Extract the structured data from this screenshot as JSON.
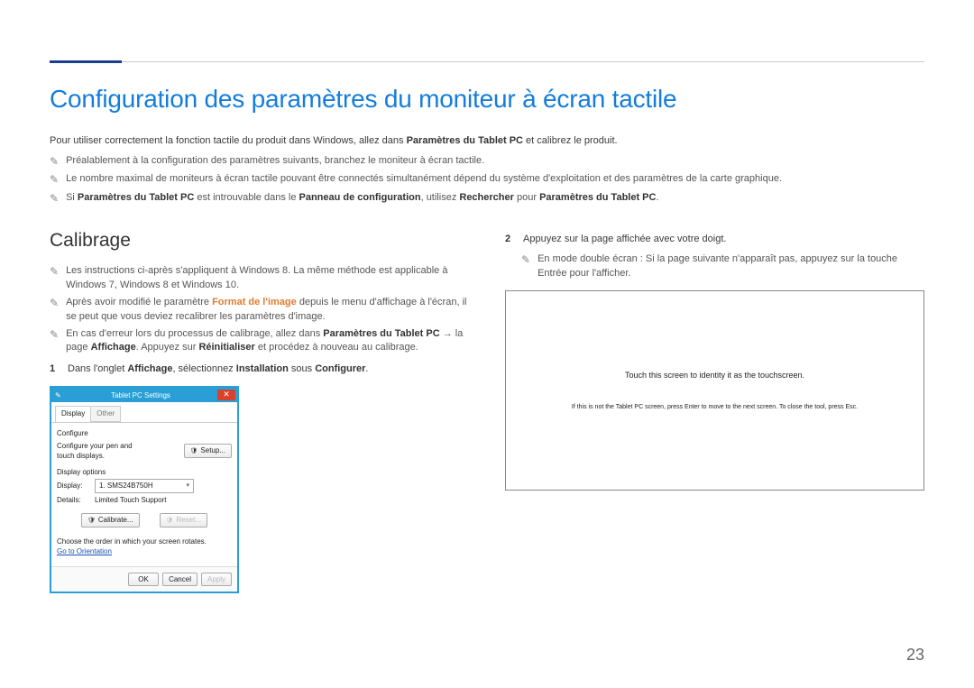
{
  "pageNumber": "23",
  "title": "Configuration des paramètres du moniteur à écran tactile",
  "intro_pre": "Pour utiliser correctement la fonction tactile du produit dans Windows, allez dans ",
  "intro_strong": "Paramètres du Tablet PC",
  "intro_post": " et calibrez le produit.",
  "notes_top": [
    "Préalablement à la configuration des paramètres suivants, branchez le moniteur à écran tactile.",
    "Le nombre maximal de moniteurs à écran tactile pouvant être connectés simultanément dépend du système d'exploitation et des paramètres de la carte graphique."
  ],
  "note3": {
    "pre": "Si ",
    "s1": "Paramètres du Tablet PC",
    "mid1": " est introuvable dans le ",
    "s2": "Panneau de configuration",
    "mid2": ", utilisez ",
    "s3": "Rechercher",
    "mid3": " pour ",
    "s4": "Paramètres du Tablet PC",
    "post": "."
  },
  "left": {
    "heading": "Calibrage",
    "note1": "Les instructions ci-après s'appliquent à Windows 8. La même méthode est applicable à Windows 7, Windows 8 et Windows 10.",
    "note2_pre": "Après avoir modifié le paramètre ",
    "note2_link": "Format de l'image",
    "note2_post": " depuis le menu d'affichage à l'écran, il se peut que vous deviez recalibrer les paramètres d'image.",
    "note3_pre": "En cas d'erreur lors du processus de calibrage, allez dans ",
    "note3_s1": "Paramètres du Tablet PC",
    "note3_arrow": " → la page ",
    "note3_s2": "Affichage",
    "note3_mid": ". Appuyez sur ",
    "note3_s3": "Réinitialiser",
    "note3_post": " et procédez à nouveau au calibrage.",
    "step1_pre": "Dans l'onglet ",
    "step1_s1": "Affichage",
    "step1_mid": ", sélectionnez ",
    "step1_s2": "Installation",
    "step1_mid2": " sous ",
    "step1_s3": "Configurer",
    "step1_post": "."
  },
  "dialog": {
    "title": "Tablet PC Settings",
    "tab_display": "Display",
    "tab_other": "Other",
    "configure_heading": "Configure",
    "configure_text": "Configure your pen and touch displays.",
    "setup_btn": "Setup...",
    "display_options": "Display options",
    "display_label": "Display:",
    "display_value": "1. SMS24B750H",
    "details_label": "Details:",
    "details_value": "Limited Touch Support",
    "calibrate_btn": "Calibrate...",
    "reset_btn": "Reset...",
    "rotate_text": "Choose the order in which your screen rotates.",
    "orientation_link": "Go to Orientation",
    "ok": "OK",
    "cancel": "Cancel",
    "apply": "Apply"
  },
  "right": {
    "step2": "Appuyez sur la page affichée avec votre doigt.",
    "note": "En mode double écran : Si la page suivante n'apparaît pas, appuyez sur la touche Entrée pour l'afficher.",
    "cal_line1": "Touch this screen to identity it as the touchscreen.",
    "cal_line2": "If this is not the Tablet PC screen, press Enter to move to the next screen. To close the tool, press Esc."
  }
}
